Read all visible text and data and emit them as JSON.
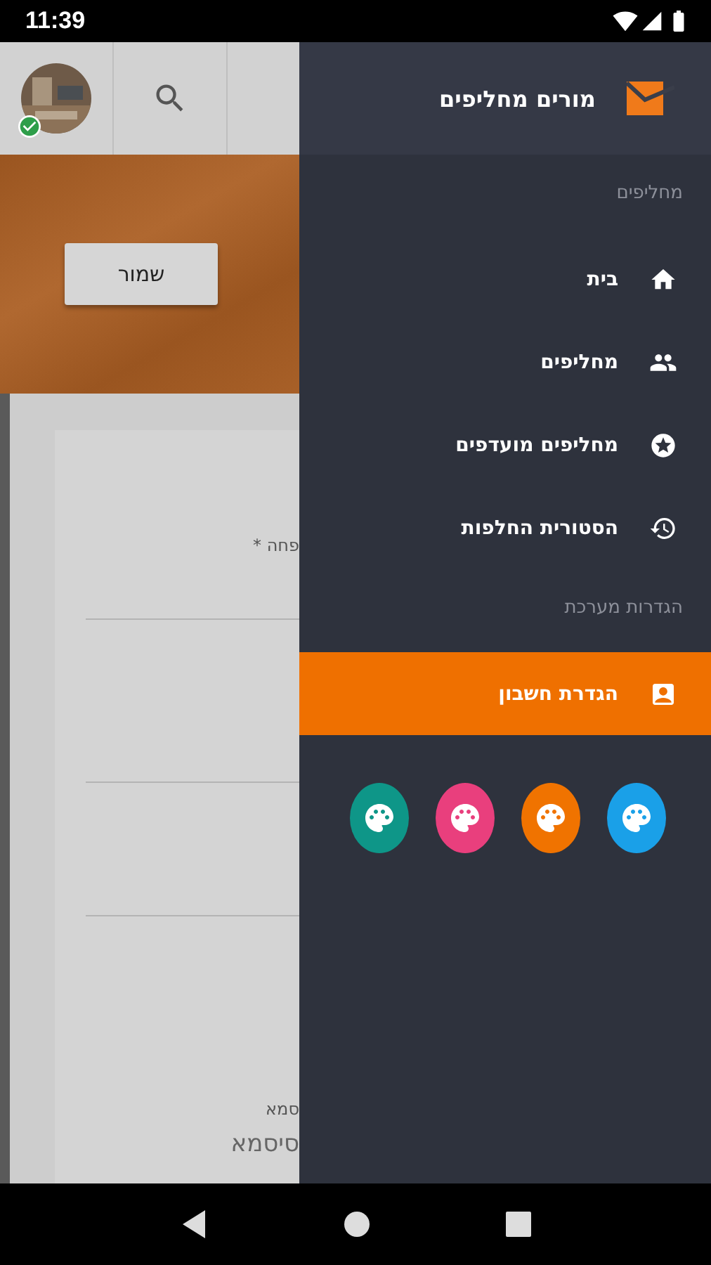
{
  "status_bar": {
    "time": "11:39"
  },
  "background_screen": {
    "save_button": "שמור",
    "field_1_label": "פחה *",
    "field_4_label": "סמא",
    "field_4_placeholder": "סיסמא"
  },
  "drawer": {
    "title": "מורים מחליפים",
    "sections": [
      {
        "heading": "מחליפים",
        "items": [
          {
            "label": "בית",
            "selected": false
          },
          {
            "label": "מחליפים",
            "selected": false
          },
          {
            "label": "מחליפים מועדפים",
            "selected": false
          },
          {
            "label": "הסטורית החלפות",
            "selected": false
          }
        ]
      },
      {
        "heading": "הגדרות מערכת",
        "items": [
          {
            "label": "הגדרת חשבון",
            "selected": true
          }
        ]
      }
    ],
    "themes": [
      {
        "color": "#1aa0e8"
      },
      {
        "color": "#f07300"
      },
      {
        "color": "#e93f7d"
      },
      {
        "color": "#0e9688"
      }
    ]
  }
}
